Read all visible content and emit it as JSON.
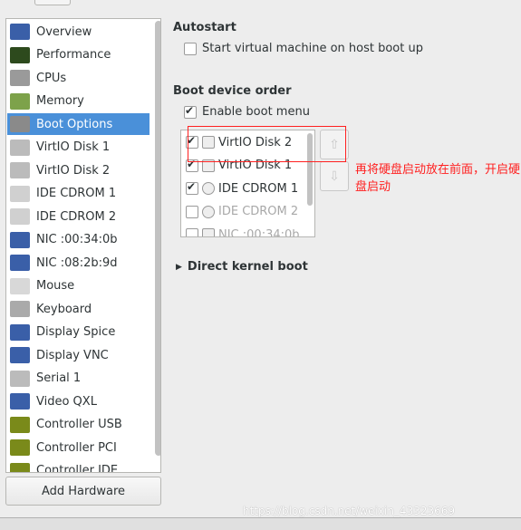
{
  "sidebar": {
    "items": [
      {
        "label": "Overview",
        "icon": "monitor-icon",
        "color": "#3a5fa8"
      },
      {
        "label": "Performance",
        "icon": "performance-graph-icon",
        "color": "#2d4a1d"
      },
      {
        "label": "CPUs",
        "icon": "cpu-chip-icon",
        "color": "#9a9a9a"
      },
      {
        "label": "Memory",
        "icon": "memory-module-icon",
        "color": "#7da24a"
      },
      {
        "label": "Boot Options",
        "icon": "gears-icon",
        "color": "#8a8a8a",
        "selected": true
      },
      {
        "label": "VirtIO Disk 1",
        "icon": "hard-disk-icon",
        "color": "#bbbbbb"
      },
      {
        "label": "VirtIO Disk 2",
        "icon": "hard-disk-icon",
        "color": "#bbbbbb"
      },
      {
        "label": "IDE CDROM 1",
        "icon": "cdrom-icon",
        "color": "#d0d0d0"
      },
      {
        "label": "IDE CDROM 2",
        "icon": "cdrom-icon",
        "color": "#d0d0d0"
      },
      {
        "label": "NIC :00:34:0b",
        "icon": "network-icon",
        "color": "#3a5fa8"
      },
      {
        "label": "NIC :08:2b:9d",
        "icon": "network-icon",
        "color": "#3a5fa8"
      },
      {
        "label": "Mouse",
        "icon": "mouse-icon",
        "color": "#d8d8d8"
      },
      {
        "label": "Keyboard",
        "icon": "keyboard-icon",
        "color": "#aaaaaa"
      },
      {
        "label": "Display Spice",
        "icon": "display-icon",
        "color": "#3a5fa8"
      },
      {
        "label": "Display VNC",
        "icon": "display-icon",
        "color": "#3a5fa8"
      },
      {
        "label": "Serial 1",
        "icon": "serial-port-icon",
        "color": "#bbbbbb"
      },
      {
        "label": "Video QXL",
        "icon": "video-card-icon",
        "color": "#3a5fa8"
      },
      {
        "label": "Controller USB",
        "icon": "controller-card-icon",
        "color": "#7a8a1a"
      },
      {
        "label": "Controller PCI",
        "icon": "controller-card-icon",
        "color": "#7a8a1a"
      },
      {
        "label": "Controller IDE",
        "icon": "controller-card-icon",
        "color": "#7a8a1a"
      }
    ],
    "add_hardware": "Add Hardware"
  },
  "autostart": {
    "title": "Autostart",
    "option": "Start virtual machine on host boot up",
    "checked": false
  },
  "boot": {
    "title": "Boot device order",
    "enable_menu": "Enable boot menu",
    "enable_checked": true,
    "devices": [
      {
        "label": "VirtIO Disk 2",
        "checked": true,
        "icon": "hard-disk-icon",
        "enabled": true
      },
      {
        "label": "VirtIO Disk 1",
        "checked": true,
        "icon": "hard-disk-icon",
        "enabled": true
      },
      {
        "label": "IDE CDROM 1",
        "checked": true,
        "icon": "cdrom-icon",
        "enabled": true
      },
      {
        "label": "IDE CDROM 2",
        "checked": false,
        "icon": "cdrom-icon",
        "enabled": false
      },
      {
        "label": "NIC :00:34:0b",
        "checked": false,
        "icon": "network-icon",
        "enabled": false
      }
    ]
  },
  "direct_kernel": "Direct kernel boot",
  "annotation": "再将硬盘启动放在前面，开启硬盘启动",
  "watermark": "https://blog.csdn.net/weixin_43323669",
  "accent": "#4a90d9"
}
